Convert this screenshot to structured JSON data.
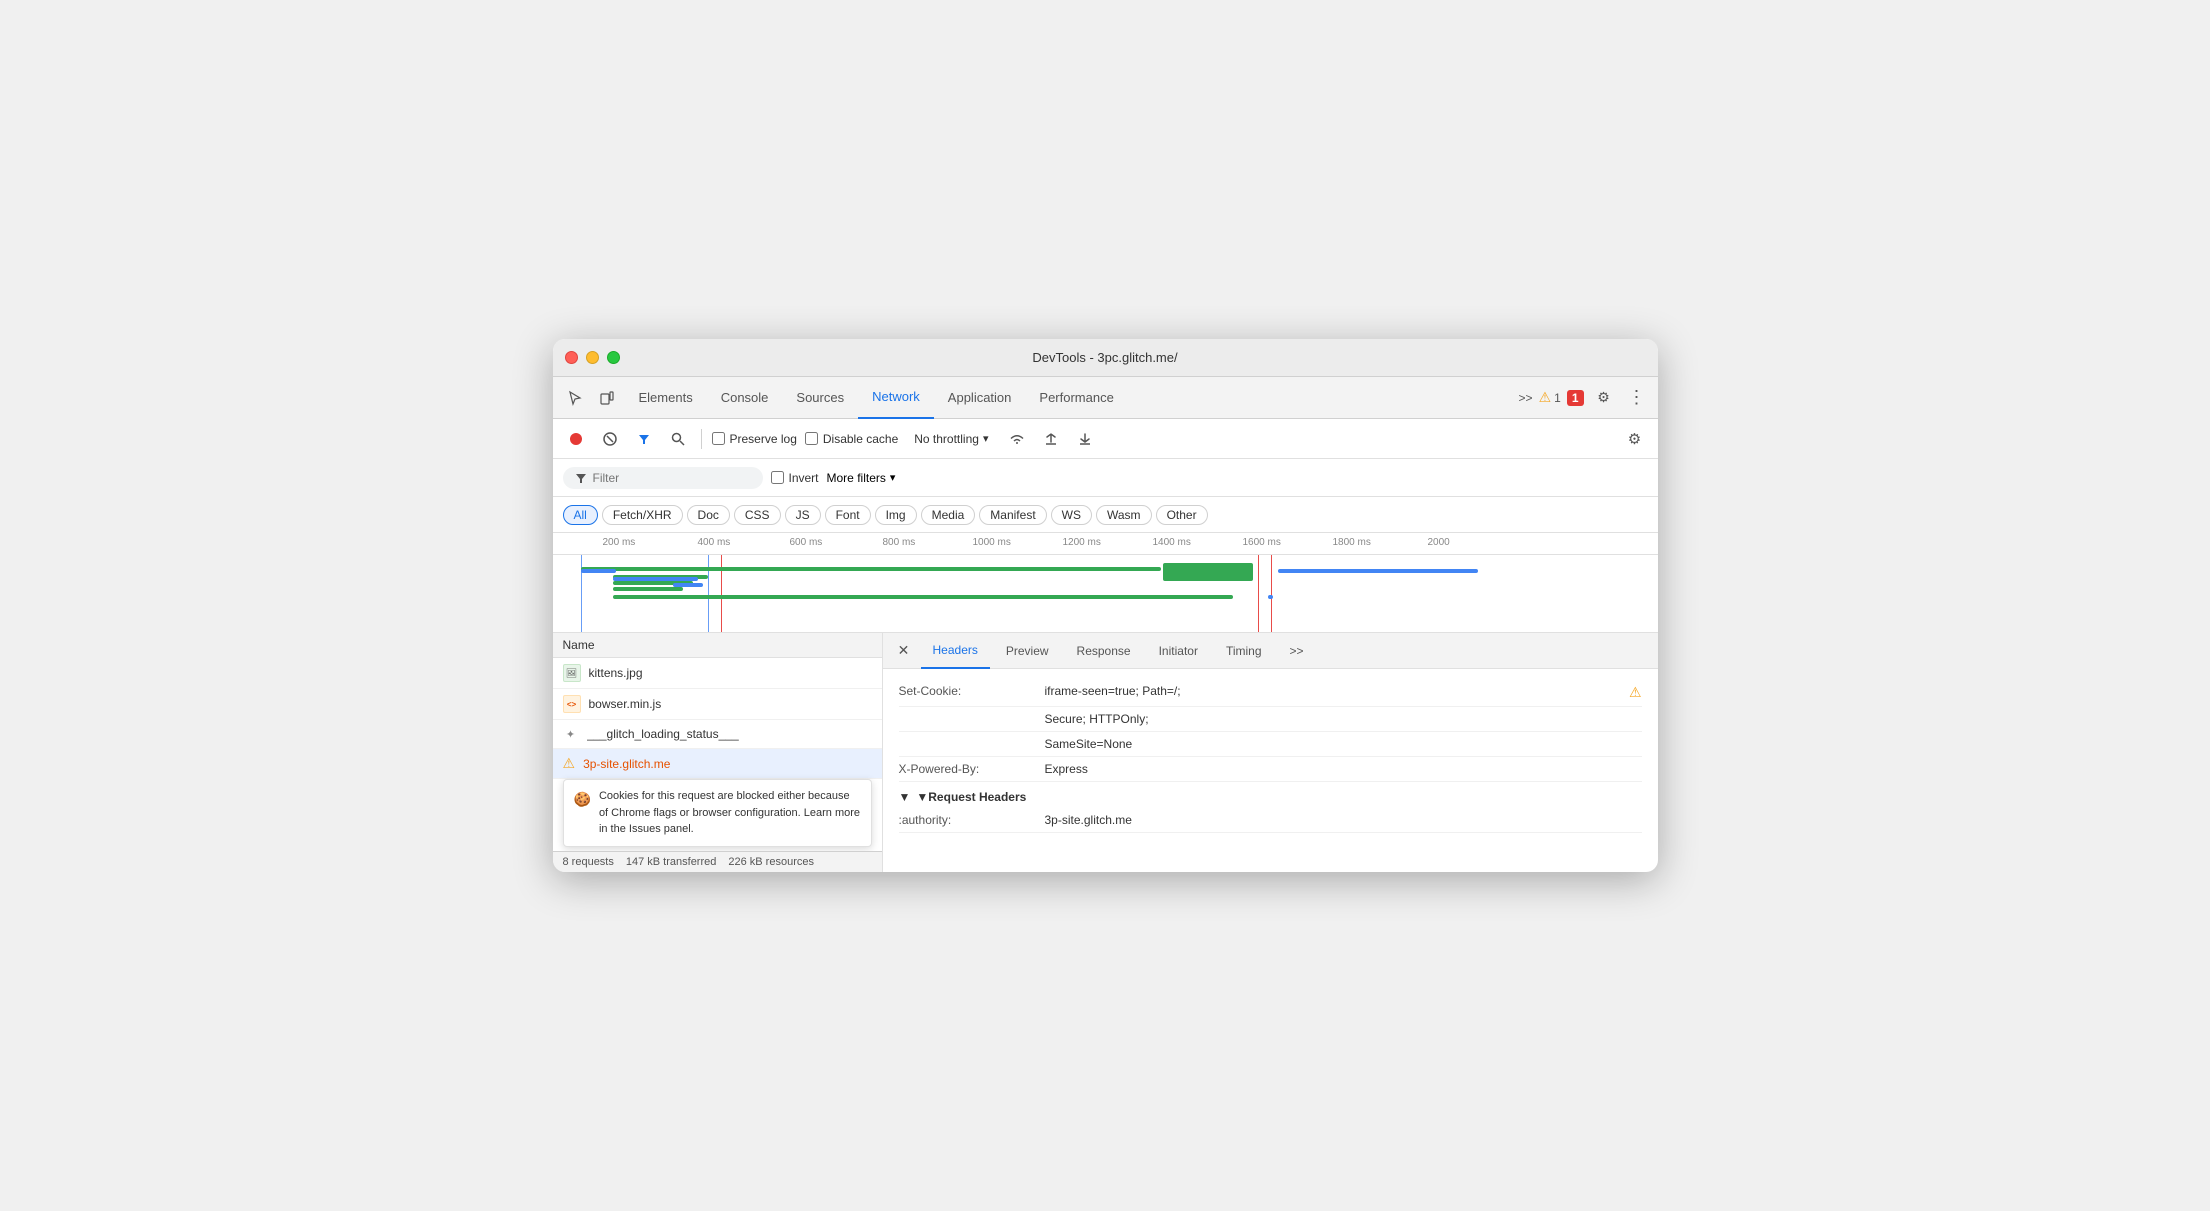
{
  "window": {
    "title": "DevTools - 3pc.glitch.me/"
  },
  "titlebar": {
    "traffic_lights": [
      "red",
      "yellow",
      "green"
    ]
  },
  "main_toolbar": {
    "icons": [
      "cursor-icon",
      "device-icon"
    ],
    "tabs": [
      {
        "label": "Elements",
        "active": false
      },
      {
        "label": "Console",
        "active": false
      },
      {
        "label": "Sources",
        "active": false
      },
      {
        "label": "Network",
        "active": true
      },
      {
        "label": "Application",
        "active": false
      },
      {
        "label": "Performance",
        "active": false
      }
    ],
    "more_label": ">>",
    "warning_count": "1",
    "error_count": "1",
    "gear_label": "⚙",
    "more_dots": "⋮"
  },
  "network_toolbar": {
    "stop_btn": "⏺",
    "clear_btn": "🚫",
    "filter_btn": "▼",
    "search_btn": "🔍",
    "preserve_log_label": "Preserve log",
    "disable_cache_label": "Disable cache",
    "throttle_label": "No throttling",
    "online_icon": "wifi",
    "import_btn": "⬆",
    "export_btn": "⬇",
    "settings_btn": "⚙"
  },
  "filter_bar": {
    "filter_placeholder": "Filter",
    "invert_label": "Invert",
    "more_filters_label": "More filters"
  },
  "type_filters": {
    "buttons": [
      {
        "label": "All",
        "active": true
      },
      {
        "label": "Fetch/XHR",
        "active": false
      },
      {
        "label": "Doc",
        "active": false
      },
      {
        "label": "CSS",
        "active": false
      },
      {
        "label": "JS",
        "active": false
      },
      {
        "label": "Font",
        "active": false
      },
      {
        "label": "Img",
        "active": false
      },
      {
        "label": "Media",
        "active": false
      },
      {
        "label": "Manifest",
        "active": false
      },
      {
        "label": "WS",
        "active": false
      },
      {
        "label": "Wasm",
        "active": false
      },
      {
        "label": "Other",
        "active": false
      }
    ]
  },
  "timeline": {
    "ticks": [
      "200 ms",
      "400 ms",
      "600 ms",
      "800 ms",
      "1000 ms",
      "1200 ms",
      "1400 ms",
      "1600 ms",
      "1800 ms",
      "2000"
    ]
  },
  "requests": {
    "header": "Name",
    "items": [
      {
        "name": "kittens.jpg",
        "icon": "🖼",
        "warning": false
      },
      {
        "name": "bowser.min.js",
        "icon": "JS",
        "warning": false
      },
      {
        "name": "___glitch_loading_status___",
        "icon": "↻",
        "warning": false
      },
      {
        "name": "3p-site.glitch.me",
        "icon": "⚠",
        "warning": true
      }
    ],
    "cookie_tooltip": "Cookies for this request are blocked either because of Chrome flags or browser configuration. Learn more in the Issues panel.",
    "cookie_icon": "🍪"
  },
  "status_bar": {
    "requests": "8 requests",
    "transferred": "147 kB transferred",
    "resources": "226 kB resources"
  },
  "detail_panel": {
    "close_btn": "✕",
    "tabs": [
      {
        "label": "Headers",
        "active": true
      },
      {
        "label": "Preview",
        "active": false
      },
      {
        "label": "Response",
        "active": false
      },
      {
        "label": "Initiator",
        "active": false
      },
      {
        "label": "Timing",
        "active": false
      },
      {
        "label": ">>",
        "active": false
      }
    ],
    "headers": [
      {
        "key": "Set-Cookie:",
        "value": "iframe-seen=true; Path=/;",
        "warning": true
      },
      {
        "key": "",
        "value": "Secure; HTTPOnly;",
        "warning": false
      },
      {
        "key": "",
        "value": "SameSite=None",
        "warning": false
      },
      {
        "key": "X-Powered-By:",
        "value": "Express",
        "warning": false
      }
    ],
    "request_headers_section": "▼Request Headers",
    "authority_key": ":authority:",
    "authority_value": "3p-site.glitch.me"
  }
}
